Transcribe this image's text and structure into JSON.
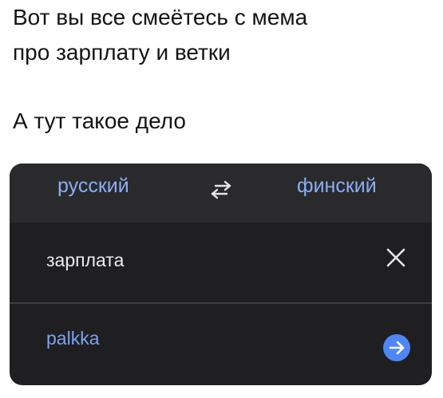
{
  "caption": {
    "line1": "Вот вы все смеётесь с мема",
    "line2": "про зарплату и ветки",
    "line3": "А тут такое дело"
  },
  "translator": {
    "source_language": "русский",
    "target_language": "финский",
    "swap_icon": "swap-arrows-icon",
    "input_text": "зарплата",
    "clear_icon": "close-icon",
    "output_text": "palkka",
    "go_icon": "arrow-right-circle-icon",
    "colors": {
      "accent": "#8aaef5",
      "panel_background": "#1f1f21",
      "lang_bar_background": "#2a2a2c",
      "go_button": "#4f86f7"
    }
  }
}
